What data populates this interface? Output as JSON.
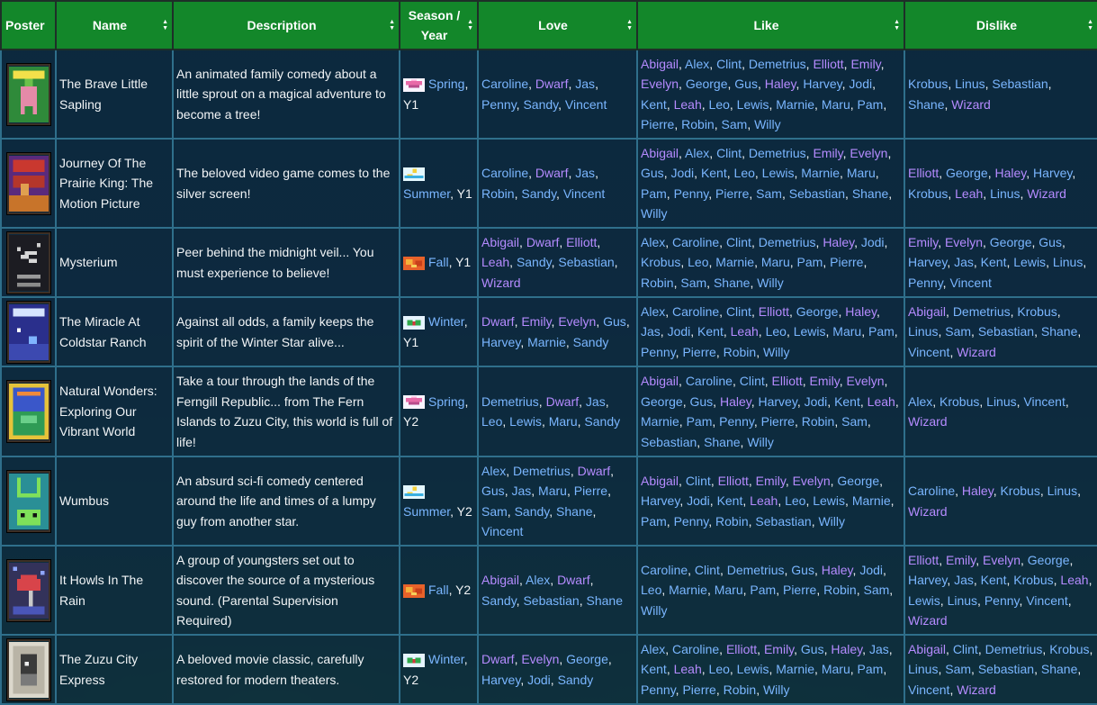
{
  "colors": {
    "header_bg": "#13872a",
    "cell_bg": "#0b263a",
    "link_blue": "#7ab6ff",
    "link_purple": "#b58bff"
  },
  "columns": [
    "Poster",
    "Name",
    "Description",
    "Season / Year",
    "Love",
    "Like",
    "Dislike"
  ],
  "rows": [
    {
      "poster_icon": "sapling-poster-icon",
      "name": "The Brave Little Sapling",
      "description": "An animated family comedy about a little sprout on a magical adventure to become a tree!",
      "season_icon": "spring-icon",
      "season": "Spring",
      "year": "Y1",
      "love": [
        "Caroline",
        "Dwarf",
        "Jas",
        "Penny",
        "Sandy",
        "Vincent"
      ],
      "like": [
        "Abigail",
        "Alex",
        "Clint",
        "Demetrius",
        "Elliott",
        "Emily",
        "Evelyn",
        "George",
        "Gus",
        "Haley",
        "Harvey",
        "Jodi",
        "Kent",
        "Leah",
        "Leo",
        "Lewis",
        "Marnie",
        "Maru",
        "Pam",
        "Pierre",
        "Robin",
        "Sam",
        "Willy"
      ],
      "dislike": [
        "Krobus",
        "Linus",
        "Sebastian",
        "Shane",
        "Wizard"
      ]
    },
    {
      "poster_icon": "prairie-king-poster-icon",
      "name": "Journey Of The Prairie King: The Motion Picture",
      "description": "The beloved video game comes to the silver screen!",
      "season_icon": "summer-icon",
      "season": "Summer",
      "year": "Y1",
      "love": [
        "Caroline",
        "Dwarf",
        "Jas",
        "Robin",
        "Sandy",
        "Vincent"
      ],
      "like": [
        "Abigail",
        "Alex",
        "Clint",
        "Demetrius",
        "Emily",
        "Evelyn",
        "Gus",
        "Jodi",
        "Kent",
        "Leo",
        "Lewis",
        "Marnie",
        "Maru",
        "Pam",
        "Penny",
        "Pierre",
        "Sam",
        "Sebastian",
        "Shane",
        "Willy"
      ],
      "dislike": [
        "Elliott",
        "George",
        "Haley",
        "Harvey",
        "Krobus",
        "Leah",
        "Linus",
        "Wizard"
      ]
    },
    {
      "poster_icon": "mysterium-poster-icon",
      "name": "Mysterium",
      "description": "Peer behind the midnight veil... You must experience to believe!",
      "season_icon": "fall-icon",
      "season": "Fall",
      "year": "Y1",
      "love": [
        "Abigail",
        "Dwarf",
        "Elliott",
        "Leah",
        "Sandy",
        "Sebastian",
        "Wizard"
      ],
      "like": [
        "Alex",
        "Caroline",
        "Clint",
        "Demetrius",
        "Haley",
        "Jodi",
        "Krobus",
        "Leo",
        "Marnie",
        "Maru",
        "Pam",
        "Pierre",
        "Robin",
        "Sam",
        "Shane",
        "Willy"
      ],
      "dislike": [
        "Emily",
        "Evelyn",
        "George",
        "Gus",
        "Harvey",
        "Jas",
        "Kent",
        "Lewis",
        "Linus",
        "Penny",
        "Vincent"
      ]
    },
    {
      "poster_icon": "coldstar-poster-icon",
      "name": "The Miracle At Coldstar Ranch",
      "description": "Against all odds, a family keeps the spirit of the Winter Star alive...",
      "season_icon": "winter-icon",
      "season": "Winter",
      "year": "Y1",
      "love": [
        "Dwarf",
        "Emily",
        "Evelyn",
        "Gus",
        "Harvey",
        "Marnie",
        "Sandy"
      ],
      "like": [
        "Alex",
        "Caroline",
        "Clint",
        "Elliott",
        "George",
        "Haley",
        "Jas",
        "Jodi",
        "Kent",
        "Leah",
        "Leo",
        "Lewis",
        "Maru",
        "Pam",
        "Penny",
        "Pierre",
        "Robin",
        "Willy"
      ],
      "dislike": [
        "Abigail",
        "Demetrius",
        "Krobus",
        "Linus",
        "Sam",
        "Sebastian",
        "Shane",
        "Vincent",
        "Wizard"
      ]
    },
    {
      "poster_icon": "natural-wonders-poster-icon",
      "name": "Natural Wonders: Exploring Our Vibrant World",
      "description": "Take a tour through the lands of the Ferngill Republic... from The Fern Islands to Zuzu City, this world is full of life!",
      "season_icon": "spring-icon",
      "season": "Spring",
      "year": "Y2",
      "love": [
        "Demetrius",
        "Dwarf",
        "Jas",
        "Leo",
        "Lewis",
        "Maru",
        "Sandy"
      ],
      "like": [
        "Abigail",
        "Caroline",
        "Clint",
        "Elliott",
        "Emily",
        "Evelyn",
        "George",
        "Gus",
        "Haley",
        "Harvey",
        "Jodi",
        "Kent",
        "Leah",
        "Marnie",
        "Pam",
        "Penny",
        "Pierre",
        "Robin",
        "Sam",
        "Sebastian",
        "Shane",
        "Willy"
      ],
      "dislike": [
        "Alex",
        "Krobus",
        "Linus",
        "Vincent",
        "Wizard"
      ]
    },
    {
      "poster_icon": "wumbus-poster-icon",
      "name": "Wumbus",
      "description": "An absurd sci-fi comedy centered around the life and times of a lumpy guy from another star.",
      "season_icon": "summer-icon",
      "season": "Summer",
      "year": "Y2",
      "love": [
        "Alex",
        "Demetrius",
        "Dwarf",
        "Gus",
        "Jas",
        "Maru",
        "Pierre",
        "Sam",
        "Sandy",
        "Shane",
        "Vincent"
      ],
      "like": [
        "Abigail",
        "Clint",
        "Elliott",
        "Emily",
        "Evelyn",
        "George",
        "Harvey",
        "Jodi",
        "Kent",
        "Leah",
        "Leo",
        "Lewis",
        "Marnie",
        "Pam",
        "Penny",
        "Robin",
        "Sebastian",
        "Willy"
      ],
      "dislike": [
        "Caroline",
        "Haley",
        "Krobus",
        "Linus",
        "Wizard"
      ]
    },
    {
      "poster_icon": "howls-poster-icon",
      "name": "It Howls In The Rain",
      "description": "A group of youngsters set out to discover the source of a mysterious sound. (Parental Supervision Required)",
      "season_icon": "fall-icon",
      "season": "Fall",
      "year": "Y2",
      "love": [
        "Abigail",
        "Alex",
        "Dwarf",
        "Sandy",
        "Sebastian",
        "Shane"
      ],
      "like": [
        "Caroline",
        "Clint",
        "Demetrius",
        "Gus",
        "Haley",
        "Jodi",
        "Leo",
        "Marnie",
        "Maru",
        "Pam",
        "Pierre",
        "Robin",
        "Sam",
        "Willy"
      ],
      "dislike": [
        "Elliott",
        "Emily",
        "Evelyn",
        "George",
        "Harvey",
        "Jas",
        "Kent",
        "Krobus",
        "Leah",
        "Lewis",
        "Linus",
        "Penny",
        "Vincent",
        "Wizard"
      ]
    },
    {
      "poster_icon": "zuzu-express-poster-icon",
      "name": "The Zuzu City Express",
      "description": "A beloved movie classic, carefully restored for modern theaters.",
      "season_icon": "winter-icon",
      "season": "Winter",
      "year": "Y2",
      "love": [
        "Dwarf",
        "Evelyn",
        "George",
        "Harvey",
        "Jodi",
        "Sandy"
      ],
      "like": [
        "Alex",
        "Caroline",
        "Elliott",
        "Emily",
        "Gus",
        "Haley",
        "Jas",
        "Kent",
        "Leah",
        "Leo",
        "Lewis",
        "Marnie",
        "Maru",
        "Pam",
        "Penny",
        "Pierre",
        "Robin",
        "Willy"
      ],
      "dislike": [
        "Abigail",
        "Clint",
        "Demetrius",
        "Krobus",
        "Linus",
        "Sam",
        "Sebastian",
        "Shane",
        "Vincent",
        "Wizard"
      ]
    }
  ]
}
